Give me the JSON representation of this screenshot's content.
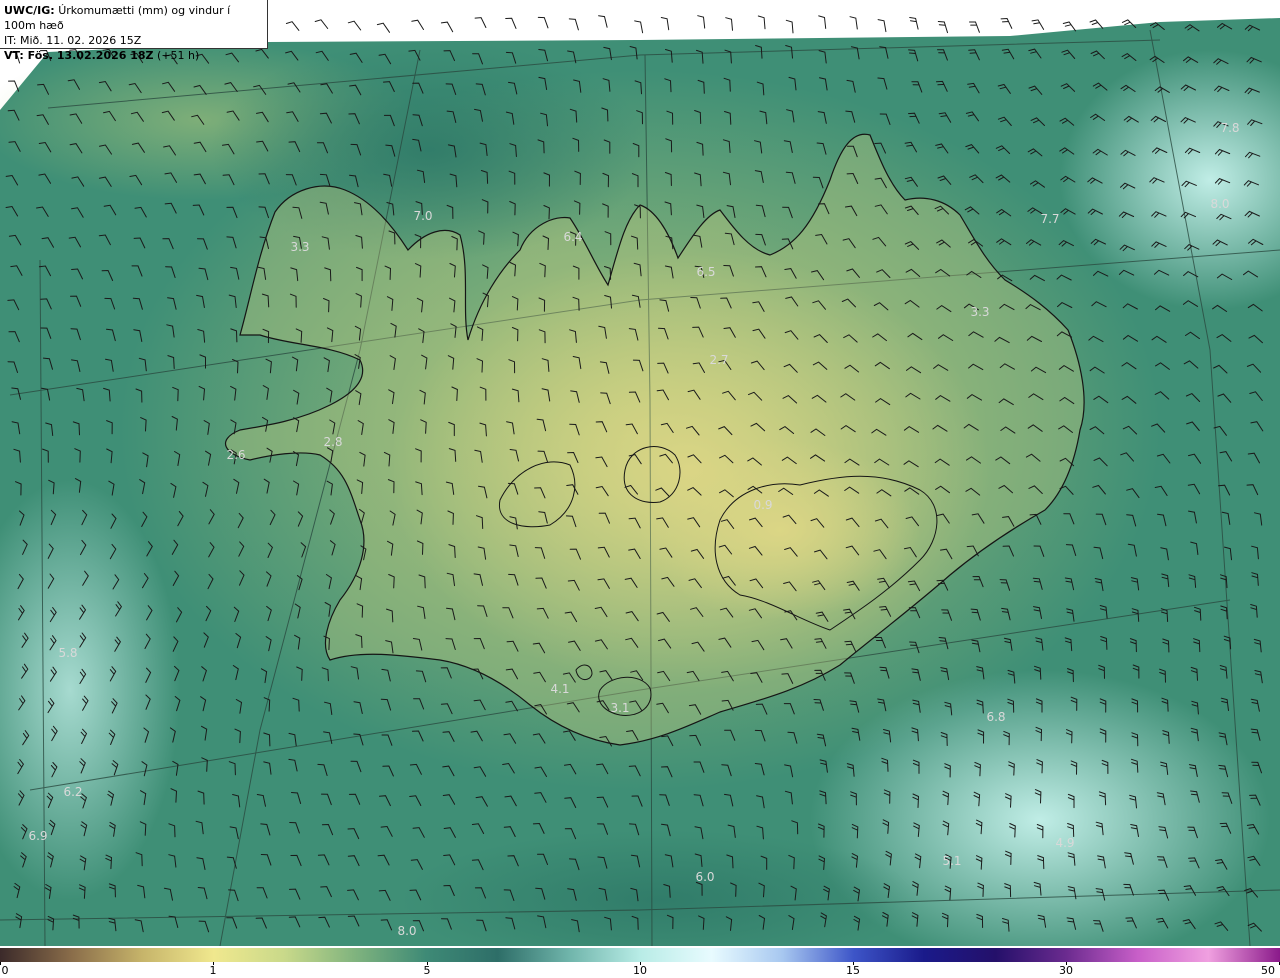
{
  "header": {
    "line1_bold": "UWC/IG:",
    "line1_text": "Úrkomumætti (mm) og vindur í 100m hæð",
    "line2": "IT: Mið. 11. 02. 2026 15Z",
    "line3_bold": "VT: Fös. 13.02.2026 18Z",
    "line3_text": "(+51 h)"
  },
  "map_labels": [
    "7.8",
    "8.0",
    "7.7",
    "7.0",
    "3.3",
    "6.4",
    "6.5",
    "3.3",
    "2.7",
    "2.8",
    "2.6",
    "0.9",
    "5.8",
    "4.1",
    "3.1",
    "6.8",
    "6.2",
    "6.9",
    "4.9",
    "5.1",
    "6.0",
    "8.0"
  ],
  "colorbar": {
    "ticks": [
      "0",
      "1",
      "5",
      "10",
      "15",
      "30",
      "50"
    ],
    "colors": [
      "#3b2a2a",
      "#8a6d4a",
      "#c6b46a",
      "#f0e88e",
      "#c9d98a",
      "#7fb37e",
      "#3e8a76",
      "#2e6e68",
      "#6fb4aa",
      "#b8ece6",
      "#e8fbff",
      "#a8c8f0",
      "#3d55c8",
      "#1a1a8a",
      "#24106a",
      "#6b2b8f",
      "#c85fc8",
      "#f0a0e0",
      "#8a1a8a"
    ]
  },
  "colors": {
    "land_light": "#e6d98a",
    "land_mid": "#a8bf74",
    "sea_dark": "#3a8a70",
    "sea_light": "#9fdcd4"
  }
}
